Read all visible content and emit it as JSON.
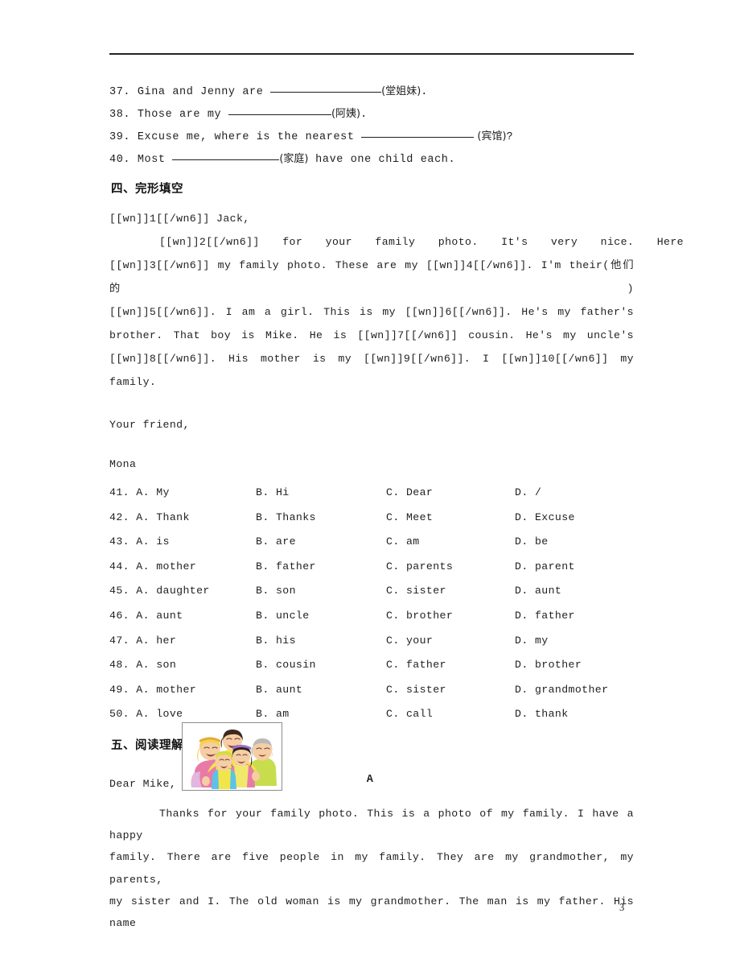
{
  "page": {
    "number": "3",
    "rule": true
  },
  "fill_in_blanks": [
    {
      "num": "37.",
      "before": "Gina and Jenny are",
      "blank_width": 138,
      "hint": "(堂姐妹)",
      "after": "."
    },
    {
      "num": "38.",
      "before": "Those are my",
      "blank_width": 128,
      "hint": "(阿姨)",
      "after": "."
    },
    {
      "num": "39.",
      "before": "Excuse me, where is the nearest",
      "blank_width": 140,
      "hint": " (宾馆)",
      "after": "?"
    },
    {
      "num": "40.",
      "before": "Most",
      "blank_width": 133,
      "hint": "(家庭)",
      "after": " have one child each."
    }
  ],
  "section_cloze": {
    "heading": "四、完形填空",
    "lines": [
      "[[wn]]1[[/wn6]] Jack,",
      "[[wn]]2[[/wn6]] for your family photo. It's very nice. Here",
      "[[wn]]3[[/wn6]] my family photo. These are my [[wn]]4[[/wn6]]. I'm their(他们的)",
      "[[wn]]5[[/wn6]]. I am a girl. This is my [[wn]]6[[/wn6]]. He's my father's",
      "brother. That boy is Mike. He is [[wn]]7[[/wn6]] cousin. He's my uncle's",
      "[[wn]]8[[/wn6]]. His mother is my [[wn]]9[[/wn6]]. I [[wn]]10[[/wn6]] my family."
    ],
    "closing": "Your friend,",
    "signature": "Mona"
  },
  "choices": [
    {
      "num": "41.",
      "a": "A. My",
      "b": "B. Hi",
      "c": "C. Dear",
      "d": "D. /"
    },
    {
      "num": "42.",
      "a": "A. Thank",
      "b": "B. Thanks",
      "c": "C. Meet",
      "d": "D. Excuse"
    },
    {
      "num": "43.",
      "a": "A. is",
      "b": "B. are",
      "c": "C. am",
      "d": "D. be"
    },
    {
      "num": "44.",
      "a": "A. mother",
      "b": "B. father",
      "c": "C. parents",
      "d": "D. parent"
    },
    {
      "num": "45.",
      "a": "A. daughter",
      "b": "B. son",
      "c": "C. sister",
      "d": "D. aunt"
    },
    {
      "num": "46.",
      "a": "A. aunt",
      "b": "B. uncle",
      "c": "C. brother",
      "d": "D. father"
    },
    {
      "num": "47.",
      "a": "A. her",
      "b": "B. his",
      "c": "C. your",
      "d": "D. my"
    },
    {
      "num": "48.",
      "a": "A. son",
      "b": "B. cousin",
      "c": "C. father",
      "d": "D. brother"
    },
    {
      "num": "49.",
      "a": "A. mother",
      "b": "B. aunt",
      "c": "C. sister",
      "d": "D. grandmother"
    },
    {
      "num": "50.",
      "a": "A. love",
      "b": "B. am",
      "c": "C. call",
      "d": "D. thank"
    }
  ],
  "section_reading": {
    "heading": "五、阅读理解",
    "passage_label": "A",
    "photo_alt": "family-photo-illustration",
    "salutation": "Dear Mike,",
    "body": [
      "Thanks for your family photo. This is a photo of my family. I have a happy",
      "family. There are five people in my family. They are my grandmother, my parents,",
      "my sister and I. The old woman is my grandmother. The man is my father. His name"
    ]
  },
  "colors": {
    "text": "#1f1f1f",
    "rule": "#242424",
    "photo_border": "#8c8c8c",
    "skin": "#f6c9a0",
    "hair_dark": "#3b2a1d",
    "hair_blonde": "#f4d34a",
    "hair_gray": "#b9b9b9",
    "shirt_pink": "#e87aa8",
    "shirt_yellow": "#f2e54a",
    "shirt_blue": "#5bc2e8",
    "shirt_green": "#c8dd4e",
    "shirt_lilac": "#e3b6dd"
  }
}
